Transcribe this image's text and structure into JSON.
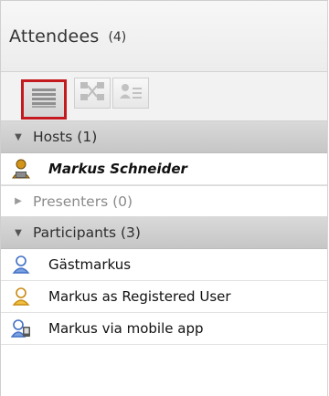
{
  "pod": {
    "title": "Attendees",
    "count": "(4)"
  },
  "toolbar": {
    "buttons": [
      {
        "icon": "list-view-icon",
        "selected": true
      },
      {
        "icon": "breakout-rooms-icon",
        "selected": false
      },
      {
        "icon": "attendee-status-icon",
        "selected": false
      }
    ]
  },
  "sections": {
    "hosts": {
      "label": "Hosts (1)",
      "expanded": true
    },
    "presenters": {
      "label": "Presenters (0)",
      "expanded": false
    },
    "participants": {
      "label": "Participants (3)",
      "expanded": true
    }
  },
  "people": {
    "host": {
      "name": "Markus Schneider",
      "icon": "host-user-icon"
    },
    "p1": {
      "name": "Gästmarkus",
      "icon": "guest-user-icon"
    },
    "p2": {
      "name": "Markus as Registered User",
      "icon": "registered-user-icon"
    },
    "p3": {
      "name": "Markus via mobile app",
      "icon": "mobile-user-icon"
    }
  },
  "colors": {
    "selected_outline": "#c4191f",
    "guest_icon": "#4a78c8",
    "registered_icon": "#e0a020",
    "host_icon": "#d49418"
  }
}
